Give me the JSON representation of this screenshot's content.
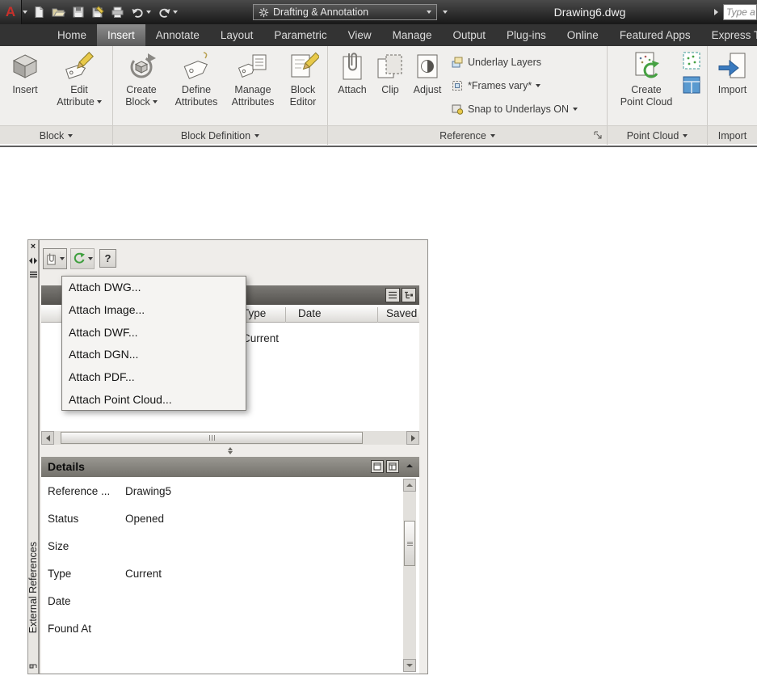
{
  "glyphs": {
    "logo": "A",
    "help": "?",
    "close": "×"
  },
  "titlebar": {
    "workspace": "Drafting & Annotation",
    "doc_title": "Drawing6.dwg",
    "search_placeholder": "Type a"
  },
  "tabs": [
    "Home",
    "Insert",
    "Annotate",
    "Layout",
    "Parametric",
    "View",
    "Manage",
    "Output",
    "Plug-ins",
    "Online",
    "Featured Apps",
    "Express Tools"
  ],
  "ribbon": {
    "block": {
      "insert": "Insert",
      "edit_line1": "Edit",
      "edit_line2": "Attribute",
      "footer": "Block"
    },
    "block_def": {
      "create_line1": "Create",
      "create_line2": "Block",
      "define_line1": "Define",
      "define_line2": "Attributes",
      "manage_line1": "Manage",
      "manage_line2": "Attributes",
      "editor_line1": "Block",
      "editor_line2": "Editor",
      "footer": "Block Definition"
    },
    "reference": {
      "attach": "Attach",
      "clip": "Clip",
      "adjust": "Adjust",
      "underlay_layers": "Underlay Layers",
      "frames": "*Frames vary*",
      "snap": "Snap to Underlays ON",
      "footer": "Reference"
    },
    "point_cloud": {
      "create_line1": "Create",
      "create_line2": "Point Cloud",
      "footer": "Point Cloud"
    },
    "import": {
      "import": "Import",
      "footer": "Import"
    }
  },
  "palette": {
    "side_label": "External References",
    "menu": {
      "items": [
        "Attach DWG...",
        "Attach Image...",
        "Attach DWF...",
        "Attach DGN...",
        "Attach PDF...",
        "Attach Point Cloud..."
      ]
    },
    "list": {
      "col_type": "Type",
      "col_date": "Date",
      "col_saved": "Saved Path",
      "row_status": "Current"
    },
    "details": {
      "title": "Details",
      "rows": [
        {
          "label": "Reference ...",
          "value": "Drawing5"
        },
        {
          "label": "Status",
          "value": "Opened"
        },
        {
          "label": "Size",
          "value": ""
        },
        {
          "label": "Type",
          "value": "Current"
        },
        {
          "label": "Date",
          "value": ""
        },
        {
          "label": "Found At",
          "value": ""
        }
      ]
    }
  }
}
